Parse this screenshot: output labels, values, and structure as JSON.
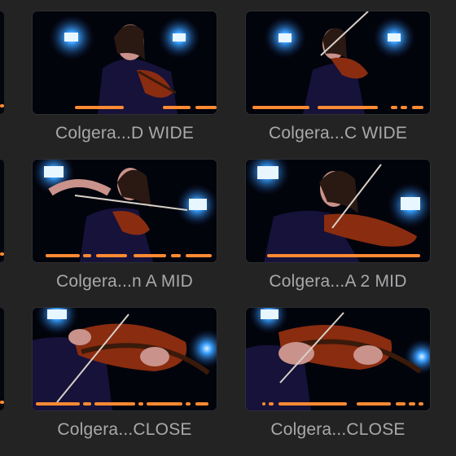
{
  "clips": [
    {
      "name": "Colgera...D WIDE"
    },
    {
      "name": "Colgera...C WIDE"
    },
    {
      "name": "Colgera...n A MID"
    },
    {
      "name": "Colgera...A 2 MID"
    },
    {
      "name": "Colgera...CLOSE"
    },
    {
      "name": "Colgera...CLOSE"
    }
  ],
  "colors": {
    "background": "#232324",
    "label_text": "#a9a9ab",
    "keyword_marker": "#ff8a32",
    "light_blue": "#3aa0ff",
    "violin": "#8a2c10",
    "dress": "#16123a"
  },
  "icons": [
    "video-thumbnail",
    "keyword-range-bar"
  ]
}
